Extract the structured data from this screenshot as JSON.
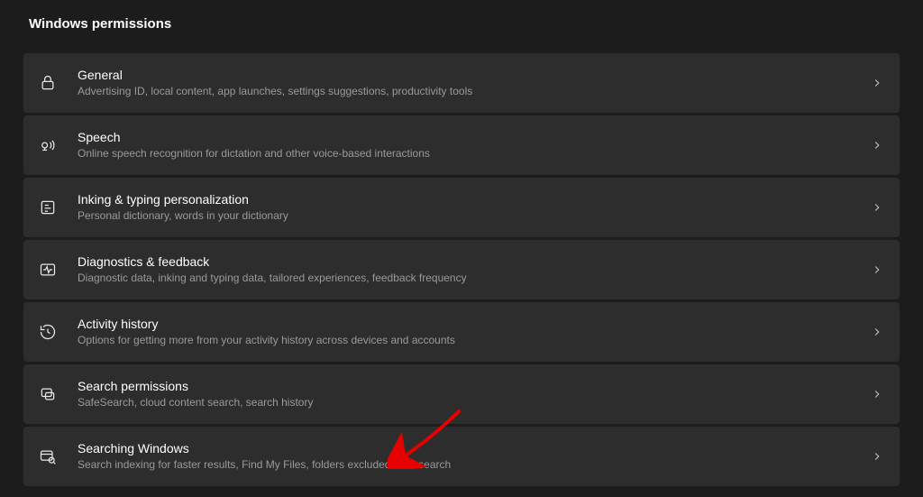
{
  "page": {
    "title": "Windows permissions"
  },
  "items": [
    {
      "title": "General",
      "desc": "Advertising ID, local content, app launches, settings suggestions, productivity tools"
    },
    {
      "title": "Speech",
      "desc": "Online speech recognition for dictation and other voice-based interactions"
    },
    {
      "title": "Inking & typing personalization",
      "desc": "Personal dictionary, words in your dictionary"
    },
    {
      "title": "Diagnostics & feedback",
      "desc": "Diagnostic data, inking and typing data, tailored experiences, feedback frequency"
    },
    {
      "title": "Activity history",
      "desc": "Options for getting more from your activity history across devices and accounts"
    },
    {
      "title": "Search permissions",
      "desc": "SafeSearch, cloud content search, search history"
    },
    {
      "title": "Searching Windows",
      "desc": "Search indexing for faster results, Find My Files, folders excluded from search"
    }
  ]
}
